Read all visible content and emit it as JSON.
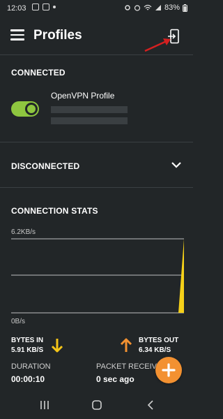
{
  "status_bar": {
    "time": "12:03",
    "battery": "83%",
    "icons": [
      "message-icon",
      "image-icon",
      "dot-icon"
    ],
    "right_icons": [
      "settings-icon",
      "alarm-icon",
      "wifi-icon",
      "signal-icon",
      "battery-icon"
    ]
  },
  "header": {
    "title": "Profiles",
    "menu_icon": "menu-icon",
    "import_icon": "import-profile-icon"
  },
  "connected": {
    "heading": "CONNECTED",
    "profile": {
      "name": "OpenVPN Profile",
      "toggle_on": true
    }
  },
  "disconnected": {
    "heading": "DISCONNECTED"
  },
  "stats": {
    "heading": "CONNECTION STATS",
    "chart_max_label": "6.2KB/s",
    "chart_min_label": "0B/s",
    "bytes_in_label": "BYTES IN",
    "bytes_in_value": "5.91 KB/S",
    "bytes_out_label": "BYTES OUT",
    "bytes_out_value": "6.34 KB/S",
    "duration_label": "DURATION",
    "duration_value": "00:00:10",
    "packet_label": "PACKET RECEIVE",
    "packet_value": "0 sec ago"
  },
  "colors": {
    "background": "#222628",
    "toggle": "#8ec63f",
    "accent_orange": "#f39131",
    "bytes_in_arrow": "#f5c518",
    "chart_spike": "#f5d019",
    "annotation_arrow": "#d42020"
  },
  "nav": [
    "recents-icon",
    "home-icon",
    "back-icon"
  ]
}
